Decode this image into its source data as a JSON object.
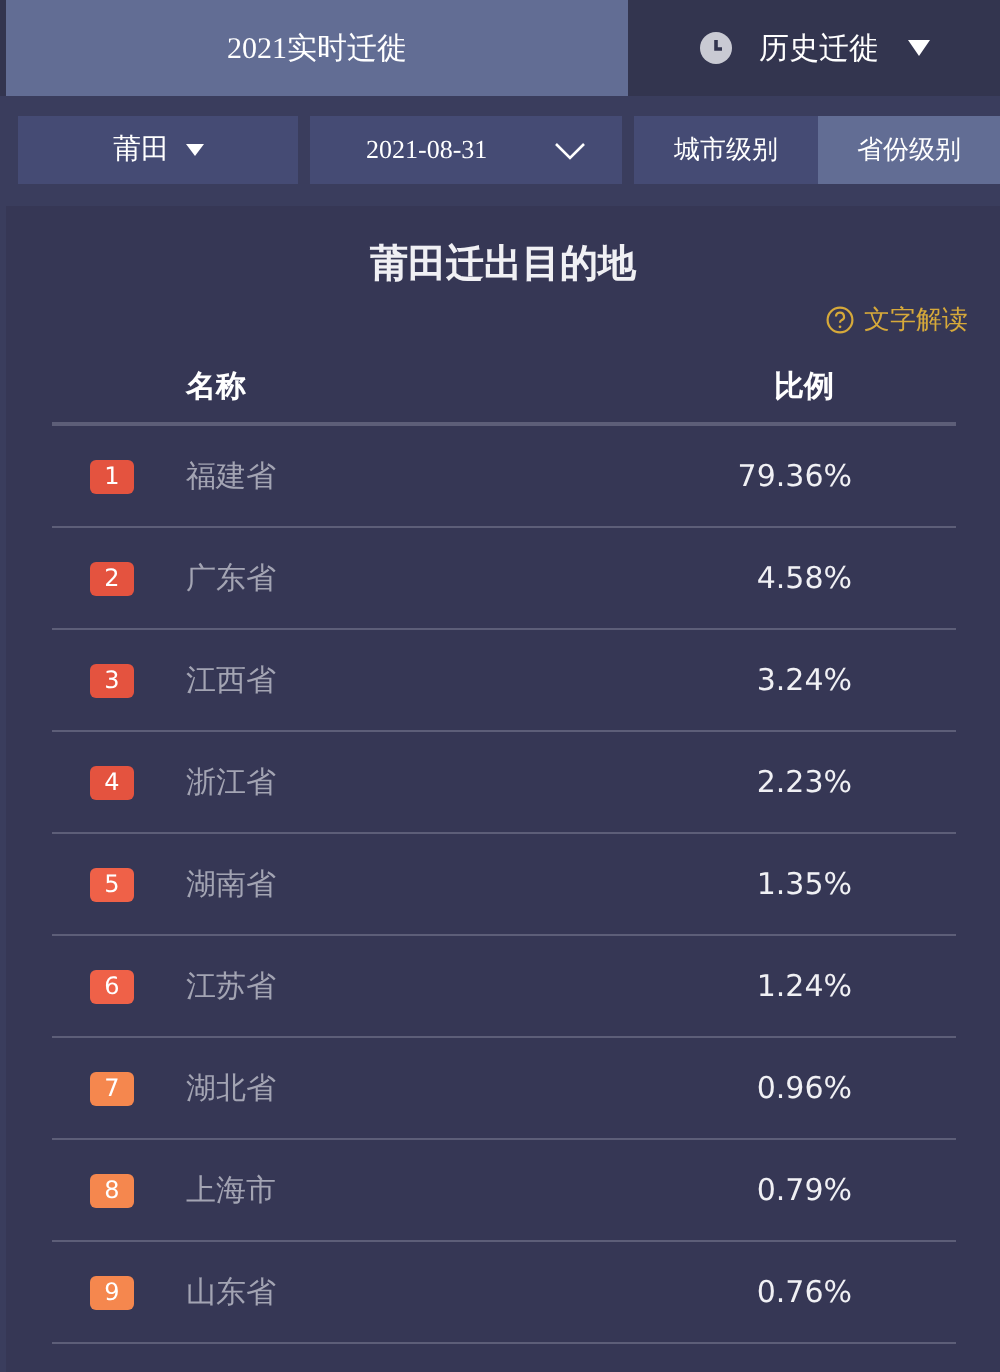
{
  "tabs": [
    {
      "label": "2021实时迁徙",
      "selected": true,
      "kind": "plain"
    },
    {
      "label": "历史迁徙",
      "selected": false,
      "kind": "history"
    }
  ],
  "city_select": {
    "value": "莆田"
  },
  "date_select": {
    "value": "2021-08-31"
  },
  "level_toggle": [
    {
      "label": "城市级别",
      "selected": false
    },
    {
      "label": "省份级别",
      "selected": true
    }
  ],
  "panel": {
    "title": "莆田迁出目的地",
    "help_link": "文字解读",
    "columns": [
      "名称",
      "比例"
    ],
    "rows": [
      {
        "rank": "1",
        "name": "福建省",
        "ratio": "79.36%",
        "color": "#e4533f"
      },
      {
        "rank": "2",
        "name": "广东省",
        "ratio": "4.58%",
        "color": "#e4533f"
      },
      {
        "rank": "3",
        "name": "江西省",
        "ratio": "3.24%",
        "color": "#e4533f"
      },
      {
        "rank": "4",
        "name": "浙江省",
        "ratio": "2.23%",
        "color": "#e4533f"
      },
      {
        "rank": "5",
        "name": "湖南省",
        "ratio": "1.35%",
        "color": "#ef6148"
      },
      {
        "rank": "6",
        "name": "江苏省",
        "ratio": "1.24%",
        "color": "#ef6148"
      },
      {
        "rank": "7",
        "name": "湖北省",
        "ratio": "0.96%",
        "color": "#f5874e"
      },
      {
        "rank": "8",
        "name": "上海市",
        "ratio": "0.79%",
        "color": "#f5874e"
      },
      {
        "rank": "9",
        "name": "山东省",
        "ratio": "0.76%",
        "color": "#f5874e"
      }
    ]
  }
}
